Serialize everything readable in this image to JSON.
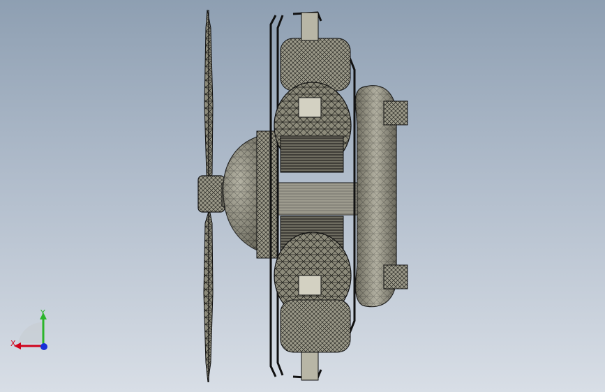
{
  "viewport": {
    "background_top": "#8e9fb2",
    "background_bottom": "#d8dee6",
    "model_description_icon": "radial-engine-wireframe-model"
  },
  "triad": {
    "x_label": "X",
    "y_label": "Y",
    "x_color": "#d0021b",
    "y_color": "#2bb52b",
    "z_color": "#1730d8"
  }
}
